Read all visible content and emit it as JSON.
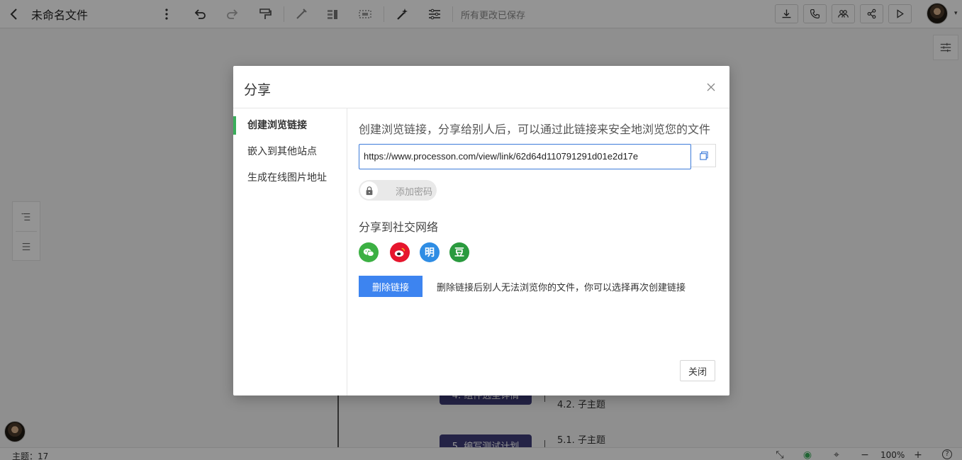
{
  "toolbar": {
    "title": "未命名文件",
    "save_status": "所有更改已保存",
    "left_icons": [
      "back-icon",
      "more-vertical-icon",
      "undo-icon",
      "redo-icon",
      "format-painter-icon",
      "pen-icon",
      "layout-icon",
      "select-box-icon",
      "magic-wand-icon",
      "structure-icon"
    ],
    "right_icons": [
      "download-icon",
      "phone-icon",
      "collaborate-icon",
      "share-icon",
      "play-icon"
    ]
  },
  "canvas": {
    "nodes": [
      {
        "label": "4. 组件选型详情"
      },
      {
        "label": "5. 编写测试计划"
      }
    ],
    "subtopics": [
      "4.2. 子主题",
      "5.1. 子主题"
    ]
  },
  "statusbar": {
    "topic_count": "主题：17",
    "zoom": "100%",
    "zoom_out": "−",
    "zoom_in": "+",
    "help": "?"
  },
  "modal": {
    "title": "分享",
    "sidebar": [
      {
        "label": "创建浏览链接",
        "active": true
      },
      {
        "label": "嵌入到其他站点",
        "active": false
      },
      {
        "label": "生成在线图片地址",
        "active": false
      }
    ],
    "intro": "创建浏览链接，分享给别人后，可以通过此链接来安全地浏览您的文件",
    "link_url": "https://www.processon.com/view/link/62d64d110791291d01e2d17e",
    "password_label": "添加密码",
    "social_title": "分享到社交网络",
    "social": [
      {
        "name": "wechat-icon",
        "glyph": "",
        "color": "#3cb043"
      },
      {
        "name": "weibo-icon",
        "glyph": "",
        "color": "#e6162d"
      },
      {
        "name": "ming-icon",
        "glyph": "明",
        "color": "#2f8de4"
      },
      {
        "name": "douban-icon",
        "glyph": "豆",
        "color": "#2a9a3e"
      }
    ],
    "delete_label": "删除链接",
    "delete_hint": "删除链接后别人无法浏览你的文件，你可以选择再次创建链接",
    "close_label": "关闭"
  },
  "colors": {
    "accent_blue": "#3d84f0",
    "active_green": "#3aae5a",
    "node_purple": "#3f3d79"
  }
}
